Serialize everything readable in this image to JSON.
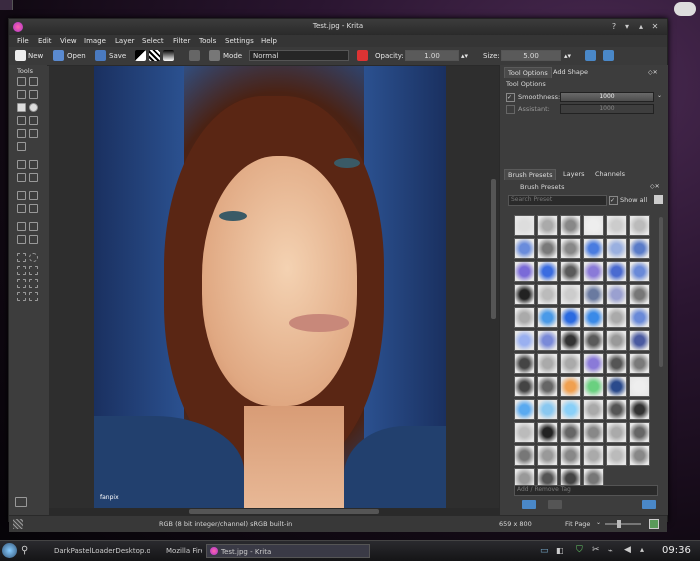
{
  "window": {
    "title": "Test.jpg - Krita"
  },
  "menu": [
    "File",
    "Edit",
    "View",
    "Image",
    "Layer",
    "Select",
    "Filter",
    "Tools",
    "Settings",
    "Help"
  ],
  "toolbar": {
    "new_label": "New",
    "open_label": "Open",
    "save_label": "Save",
    "mode_label": "Mode",
    "mode_value": "Normal",
    "opacity_label": "Opacity:",
    "opacity_value": "1.00",
    "size_label": "Size:",
    "size_value": "5.00"
  },
  "toolbox": {
    "title": "Tools"
  },
  "tool_options": {
    "tab_tool_options": "Tool Options",
    "tab_add_shape": "Add Shape",
    "header": "Tool Options",
    "smoothness_label": "Smoothness:",
    "smoothness_value": "1000",
    "assistant_label": "Assistant:",
    "assistant_value": "1000"
  },
  "brush_panel": {
    "tab_brush_presets": "Brush Presets",
    "tab_layers": "Layers",
    "tab_channels": "Channels",
    "header": "Brush Presets",
    "search_placeholder": "Search Preset",
    "show_all_label": "Show all",
    "tag_placeholder": "Add / Remove Tag"
  },
  "photo": {
    "watermark": "fanpix"
  },
  "status": {
    "color_info": "RGB (8 bit integer/channel)  sRGB built-in",
    "dimensions": "659 x 800",
    "zoom": "Fit Page"
  },
  "taskbar": {
    "tasks": [
      "DarkPastelLoaderDesktop.org",
      "Mozilla Firefox",
      "Test.jpg - Krita"
    ],
    "clock": "09:36"
  },
  "colors": {
    "bg": "#3d3d3d",
    "accent": "#4a88c8",
    "photo_blue": "#2e5590"
  },
  "brush_colors": [
    "#ddd",
    "#aaa",
    "#888",
    "#eee",
    "#ccc",
    "#bbb",
    "#6a8cdc",
    "#7a7a7a",
    "#888",
    "#4a7ce0",
    "#9ab0e0",
    "#5a7cc8",
    "#7a6ad8",
    "#3a6ce0",
    "#5a5a5a",
    "#8a7ad8",
    "#4a6ad0",
    "#6a8ad8",
    "#222",
    "#bbb",
    "#ccc",
    "#6a7aa0",
    "#9aa0d0",
    "#777",
    "#aaa",
    "#4a9ae8",
    "#2a6ae0",
    "#3a8ae8",
    "#aaa",
    "#6a8ad8",
    "#9ab0f0",
    "#7a8ad8",
    "#333",
    "#5a5a5a",
    "#999",
    "#4a5aa0",
    "#444",
    "#aaa",
    "#aaa",
    "#8a7ad8",
    "#555",
    "#7a7a7a",
    "#444",
    "#666",
    "#f0a050",
    "#6ad080",
    "#2a4a8c",
    "#eee",
    "#5aaaf0",
    "#8ac8f0",
    "#8ad0f8",
    "#aaa",
    "#555",
    "#333",
    "#bbb",
    "#222",
    "#666",
    "#888",
    "#aaa",
    "#666",
    "#777",
    "#999",
    "#888",
    "#aaa",
    "#bbb",
    "#888",
    "#999",
    "#555",
    "#444",
    "#777"
  ]
}
